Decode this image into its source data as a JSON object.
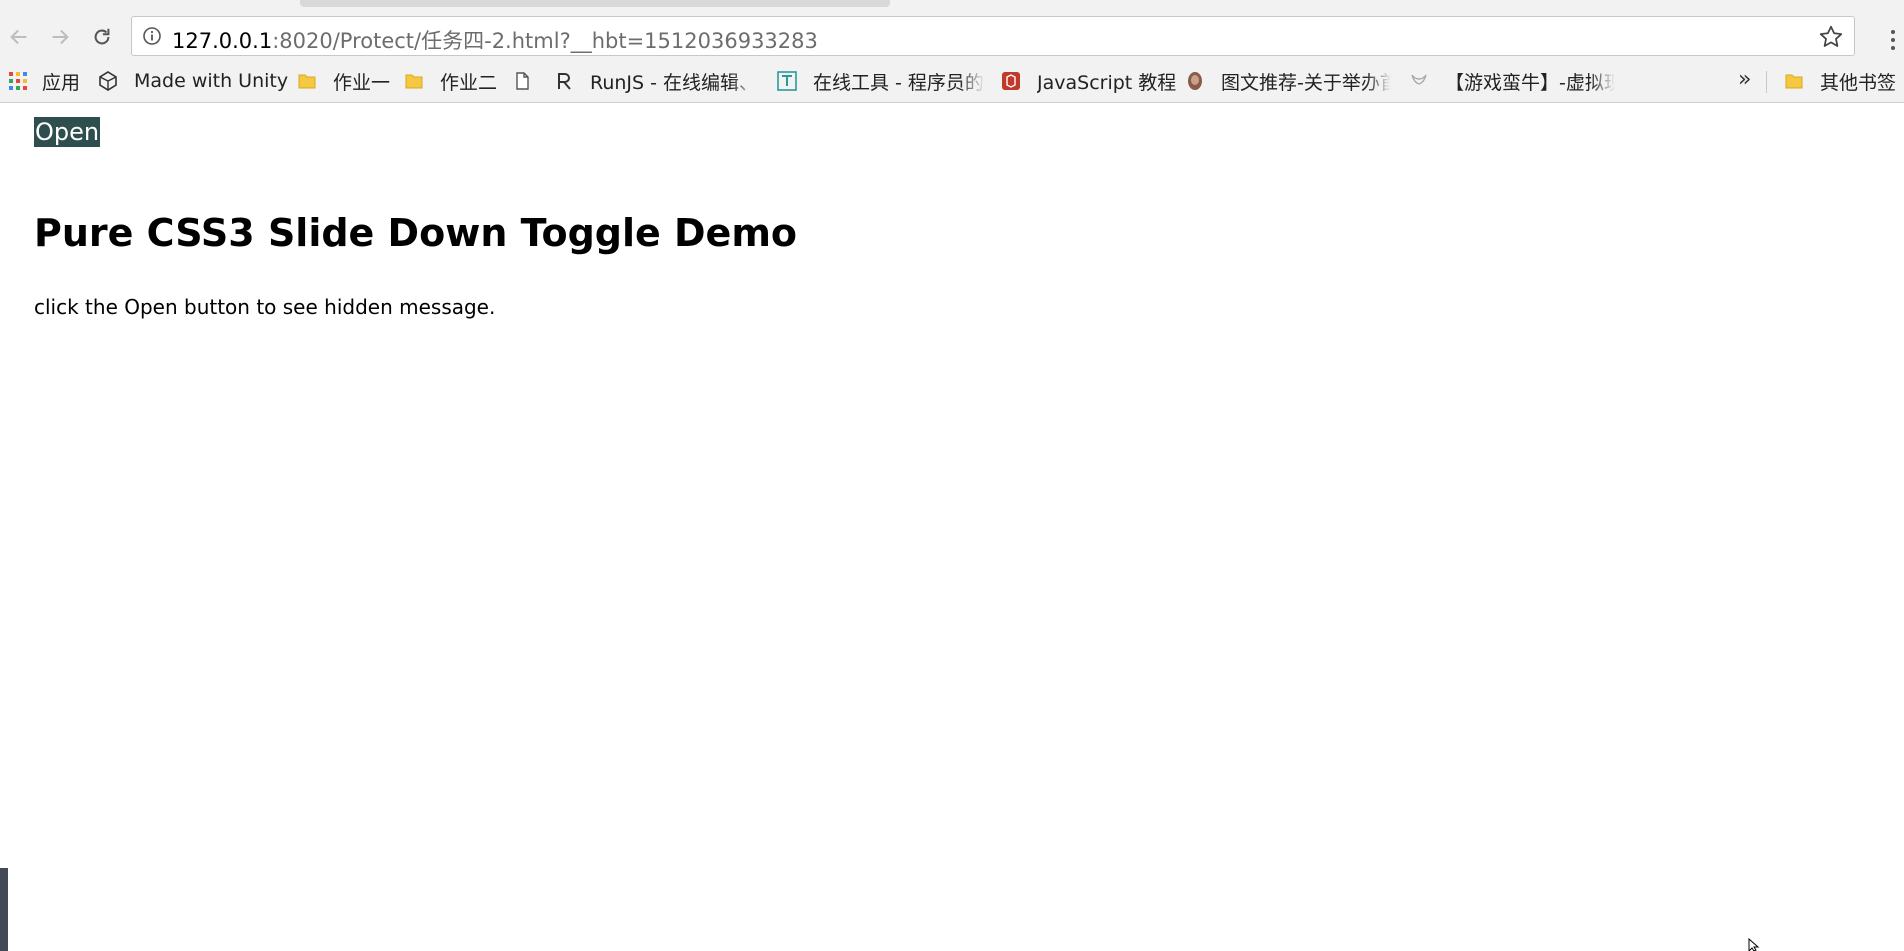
{
  "browser": {
    "url_host": "127.0.0.1",
    "url_rest": ":8020/Protect/任务四-2.html?__hbt=1512036933283",
    "nav_icons": [
      "back-arrow-icon",
      "forward-arrow-icon",
      "reload-icon"
    ],
    "omnibox_icons": [
      "info-icon",
      "star-icon"
    ],
    "menu_icon": "vertical-dots-icon"
  },
  "bookmarks": {
    "items": [
      {
        "label": "应用",
        "icon": "apps-grid-icon"
      },
      {
        "label": "Made with Unity",
        "icon": "unity-icon"
      },
      {
        "label": "作业一",
        "icon": "folder-icon"
      },
      {
        "label": "作业二",
        "icon": "folder-icon"
      },
      {
        "label": "",
        "icon": "page-icon"
      },
      {
        "label": "RunJS - 在线编辑、展",
        "icon": "runjs-icon"
      },
      {
        "label": "在线工具 - 程序员的工",
        "icon": "tool-icon"
      },
      {
        "label": "JavaScript 教程",
        "icon": "js-tutorial-icon"
      },
      {
        "label": "图文推荐-关于举办首",
        "icon": "avatar-icon"
      },
      {
        "label": "【游戏蛮牛】-虚拟现",
        "icon": "game-icon"
      },
      {
        "label": "其他书签",
        "icon": "folder-icon"
      }
    ],
    "overflow": "»"
  },
  "page": {
    "open_button": "Open",
    "title": "Pure CSS3 Slide Down Toggle Demo",
    "description": "click the Open button to see hidden message."
  },
  "colors": {
    "open_button_bg": "#2f4f4f",
    "folder_yellow": "#f5c842",
    "chrome_bg": "#f2f2f2"
  }
}
